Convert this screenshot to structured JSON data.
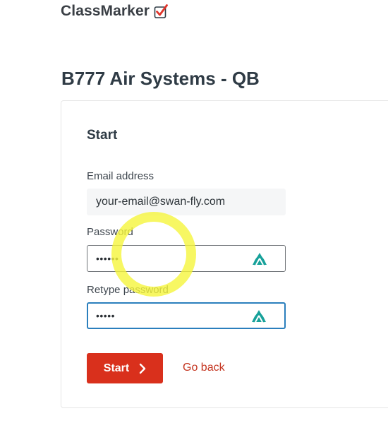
{
  "brand": {
    "name": "ClassMarker",
    "check_icon": "checkbox-check-icon",
    "accent_color": "#e0342a"
  },
  "quiz": {
    "title": "B777 Air Systems - QB"
  },
  "form": {
    "heading": "Start",
    "email": {
      "label": "Email address",
      "value": "your-email@swan-fly.com"
    },
    "password": {
      "label": "Password",
      "masked_value": "••••••",
      "manager_icon": "nordpass-icon"
    },
    "retype_password": {
      "label": "Retype password",
      "masked_value": "•••••",
      "manager_icon": "nordpass-icon"
    },
    "start_button": {
      "label": "Start",
      "icon": "chevron-right-icon",
      "color": "#d9301c"
    },
    "go_back_link": {
      "label": "Go back",
      "color": "#c4341f"
    }
  },
  "annotation": {
    "type": "yellow-highlight-ring",
    "color": "#f5f53c"
  }
}
